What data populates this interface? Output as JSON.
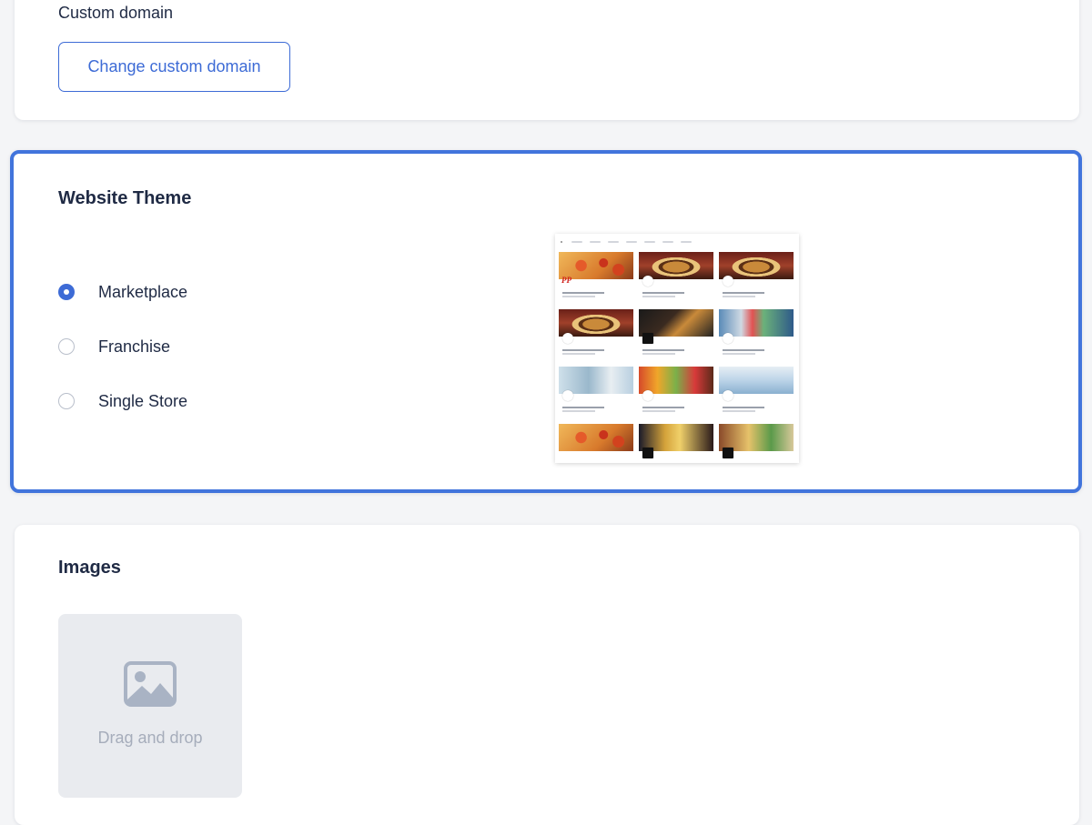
{
  "domain": {
    "label": "Custom domain",
    "button_label": "Change custom domain"
  },
  "theme": {
    "title": "Website Theme",
    "options": [
      {
        "label": "Marketplace",
        "checked": true
      },
      {
        "label": "Franchise",
        "checked": false
      },
      {
        "label": "Single Store",
        "checked": false
      }
    ],
    "preview_logo_text": "PP"
  },
  "images": {
    "title": "Images",
    "dropzone_label": "Drag and drop",
    "icon": "image-placeholder-icon"
  },
  "colors": {
    "accent": "#3d6bd6",
    "selected_border": "#4174dc",
    "text": "#1f2a44",
    "muted": "#a6adbb"
  }
}
